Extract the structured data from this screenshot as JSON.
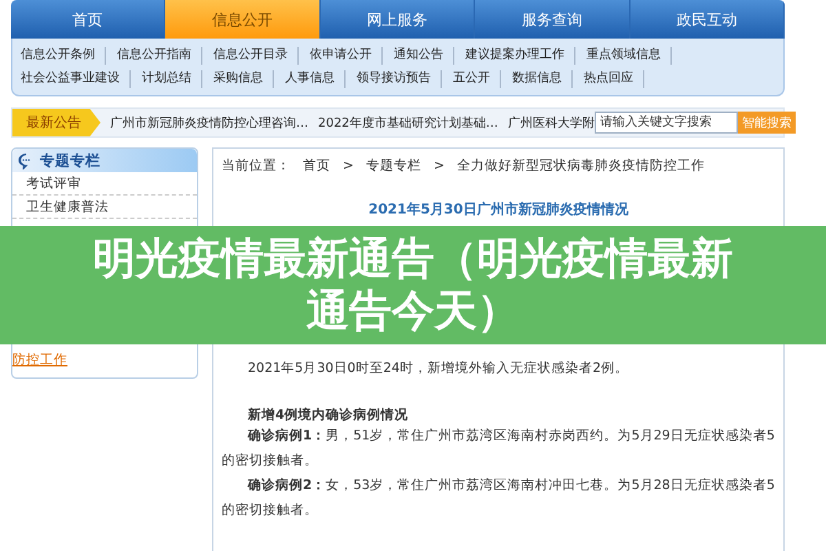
{
  "nav": {
    "tabs": [
      {
        "label": "首页",
        "selected": false
      },
      {
        "label": "信息公开",
        "selected": true
      },
      {
        "label": "网上服务",
        "selected": false
      },
      {
        "label": "服务查询",
        "selected": false
      },
      {
        "label": "政民互动",
        "selected": false
      }
    ]
  },
  "submenu": {
    "links": [
      "信息公开条例",
      "信息公开指南",
      "信息公开目录",
      "依申请公开",
      "通知公告",
      "建议提案办理工作",
      "重点领域信息",
      "社会公益事业建设",
      "计划总结",
      "采购信息",
      "人事信息",
      "领导接访预告",
      "五公开",
      "数据信息",
      "热点回应"
    ]
  },
  "announcement": {
    "label": "最新公告",
    "items": [
      "广州市新冠肺炎疫情防控心理咨询…",
      "2022年度市基础研究计划基础…",
      "广州医科大学附"
    ]
  },
  "search": {
    "placeholder": "请输入关键文字搜索",
    "button": "智能搜索"
  },
  "sidebar": {
    "title": "专题专栏",
    "items": [
      "考试评审",
      "卫生健康普法"
    ],
    "tail": "防控工作"
  },
  "breadcrumb": {
    "label": "当前位置：",
    "separator": ">",
    "items": [
      "首页",
      "专题专栏",
      "全力做好新型冠状病毒肺炎疫情防控工作"
    ]
  },
  "article": {
    "title": "2021年5月30日广州市新冠肺炎疫情情况",
    "blocks": [
      {
        "kind": "para",
        "text": "2021年5月30日0时至24时，新增境外输入无症状感染者2例。"
      },
      {
        "kind": "heading",
        "text": "新增4例境内确诊病例情况"
      },
      {
        "kind": "para",
        "text": "**确诊病例1：**男，51岁，常住广州市荔湾区海南村赤岗西约。为5月29日无症状感染者5的密切接触者。"
      },
      {
        "kind": "para",
        "text": "**确诊病例2：**女，53岁，常住广州市荔湾区海南村冲田七巷。为5月28日无症状感染者5的密切接触者。"
      }
    ]
  },
  "banner": {
    "title": "明光疫情最新通告（明光疫情最新通告今天）"
  }
}
